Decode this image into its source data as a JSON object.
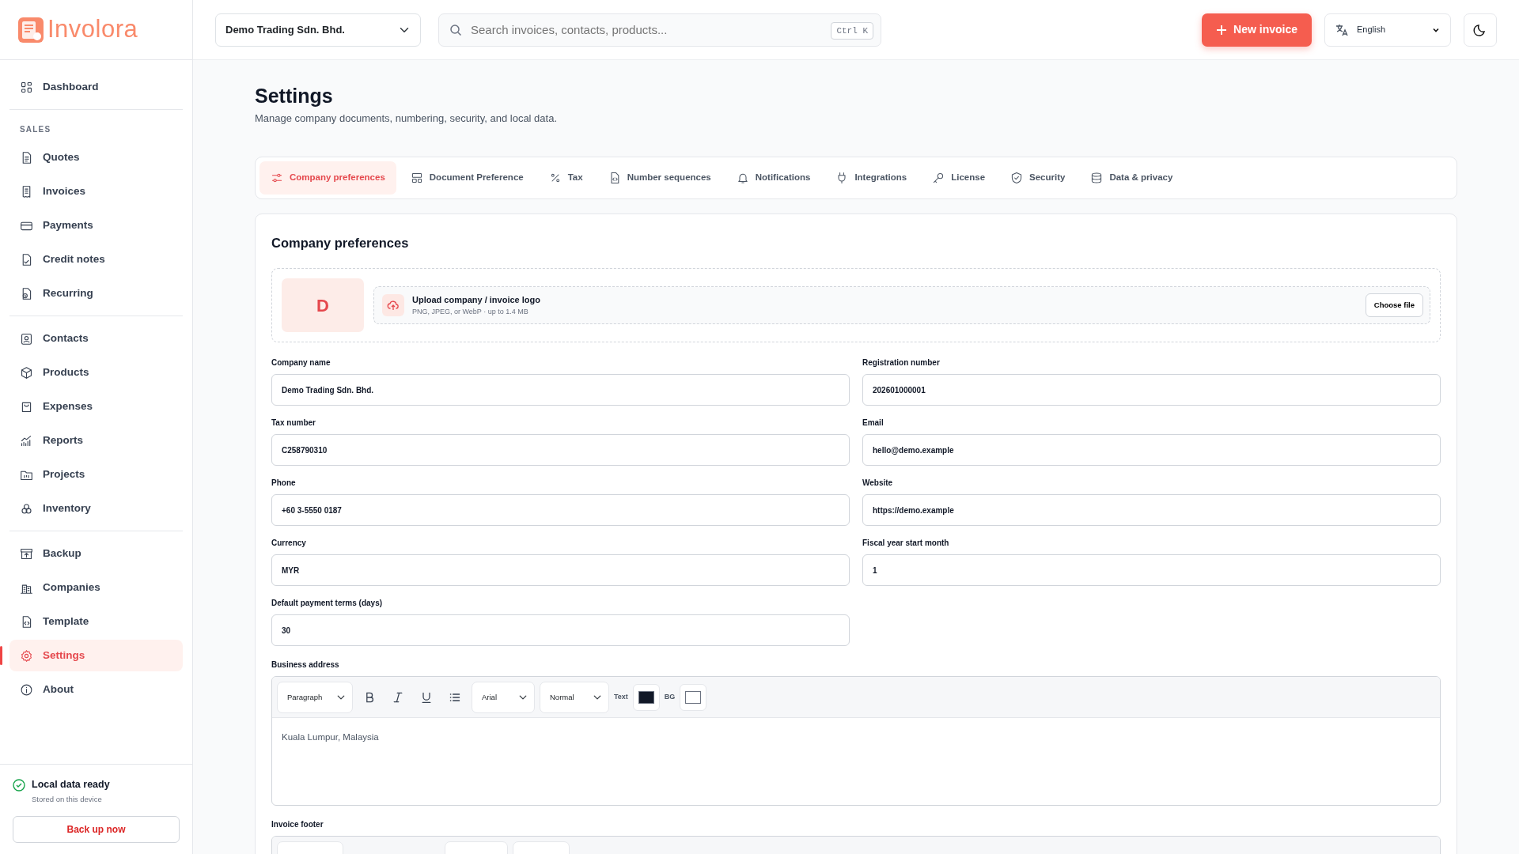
{
  "brand": {
    "name": "Involora"
  },
  "sidebar": {
    "groups": [
      {
        "items": [
          {
            "label": "Dashboard",
            "selected": false
          }
        ]
      },
      {
        "heading": "SALES",
        "items": [
          {
            "label": "Quotes",
            "selected": false
          },
          {
            "label": "Invoices",
            "selected": false
          },
          {
            "label": "Payments",
            "selected": false
          },
          {
            "label": "Credit notes",
            "selected": false
          },
          {
            "label": "Recurring",
            "selected": false
          }
        ]
      },
      {
        "items": [
          {
            "label": "Contacts",
            "selected": false
          },
          {
            "label": "Products",
            "selected": false
          },
          {
            "label": "Expenses",
            "selected": false
          },
          {
            "label": "Reports",
            "selected": false
          },
          {
            "label": "Projects",
            "selected": false
          },
          {
            "label": "Inventory",
            "selected": false
          }
        ]
      },
      {
        "items": [
          {
            "label": "Backup",
            "selected": false
          },
          {
            "label": "Companies",
            "selected": false
          },
          {
            "label": "Template",
            "selected": false
          },
          {
            "label": "Settings",
            "selected": true
          },
          {
            "label": "About",
            "selected": false
          }
        ]
      }
    ],
    "status": {
      "title": "Local data ready",
      "subtitle": "Stored on this device",
      "button": "Back up now"
    }
  },
  "topbar": {
    "company": "Demo Trading Sdn. Bhd.",
    "search": {
      "placeholder": "Search invoices, contacts, products...",
      "shortcut": "Ctrl K"
    },
    "new_button": "New invoice",
    "language": "English"
  },
  "page": {
    "title": "Settings",
    "subtitle": "Manage company documents, numbering, security, and local data."
  },
  "tabs": [
    {
      "label": "Company preferences",
      "selected": true
    },
    {
      "label": "Document Preference",
      "selected": false
    },
    {
      "label": "Tax",
      "selected": false
    },
    {
      "label": "Number sequences",
      "selected": false
    },
    {
      "label": "Notifications",
      "selected": false
    },
    {
      "label": "Integrations",
      "selected": false
    },
    {
      "label": "License",
      "selected": false
    },
    {
      "label": "Security",
      "selected": false
    },
    {
      "label": "Data & privacy",
      "selected": false
    }
  ],
  "section": {
    "title": "Company preferences",
    "logo": {
      "letter": "D",
      "title": "Upload company / invoice logo",
      "hint": "PNG, JPEG, or WebP · up to 1.4 MB",
      "button": "Choose file"
    },
    "fields": [
      {
        "label": "Company name",
        "value": "Demo Trading Sdn. Bhd."
      },
      {
        "label": "Registration number",
        "value": "202601000001"
      },
      {
        "label": "Tax number",
        "value": "C258790310"
      },
      {
        "label": "Email",
        "value": "hello@demo.example"
      },
      {
        "label": "Phone",
        "value": "+60 3-5550 0187"
      },
      {
        "label": "Website",
        "value": "https://demo.example"
      },
      {
        "label": "Currency",
        "value": "MYR"
      },
      {
        "label": "Fiscal year start month",
        "value": "1"
      },
      {
        "label": "Default payment terms (days)",
        "value": "30"
      }
    ],
    "address": {
      "label": "Business address",
      "block": "Paragraph",
      "font": "Arial",
      "size": "Normal",
      "text_label": "Text",
      "bg_label": "BG",
      "content": "Kuala Lumpur, Malaysia"
    },
    "footer": {
      "label": "Invoice footer"
    }
  }
}
